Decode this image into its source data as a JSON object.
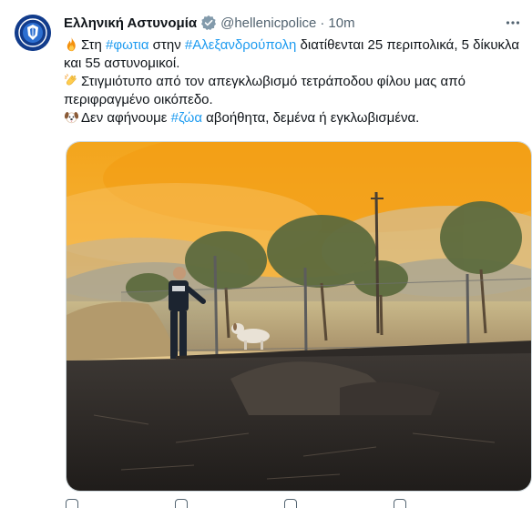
{
  "tweet": {
    "author_name": "Ελληνική Αστυνομία",
    "handle": "@hellenicpolice",
    "separator": "·",
    "time": "10m",
    "lines": [
      {
        "emoji": "fire-emoji",
        "parts": [
          {
            "text": "Στη ",
            "type": "text"
          },
          {
            "text": "#φωτια",
            "type": "hashtag"
          },
          {
            "text": " στην ",
            "type": "text"
          },
          {
            "text": "#Αλεξανδρούπολη",
            "type": "hashtag"
          },
          {
            "text": " διατίθενται 25 περιπολικά, 5 δίκυκλα και 55 αστυνομικοί.",
            "type": "text"
          }
        ]
      },
      {
        "emoji": "clapping-hands-emoji",
        "parts": [
          {
            "text": "Στιγμιότυπο από τον απεγκλωβισμό τετράποδου φίλου μας από περιφραγμένο οικόπεδο.",
            "type": "text"
          }
        ]
      },
      {
        "emoji": "dog-face-emoji",
        "parts": [
          {
            "text": "Δεν αφήνουμε ",
            "type": "text"
          },
          {
            "text": "#ζώα",
            "type": "hashtag"
          },
          {
            "text": " αβοήθητα, δεμένα ή εγκλωβισμένα.",
            "type": "text"
          }
        ]
      }
    ]
  },
  "icons": {
    "verified": "verified-badge-icon",
    "more": "more-options-icon"
  },
  "colors": {
    "hashtag": "#1d9bf0",
    "secondary_text": "#536471",
    "primary_text": "#0f1419",
    "sky_fire": "#f4a020"
  }
}
